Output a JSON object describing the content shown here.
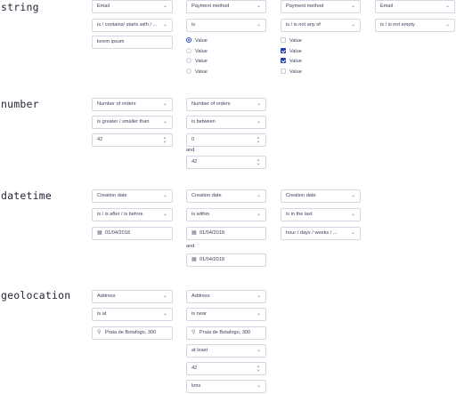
{
  "sections": {
    "string": "string",
    "number": "number",
    "datetime": "datetime",
    "geolocation": "geolocation"
  },
  "string": {
    "col1": {
      "field": "Email",
      "operator": "is / contains/ starts with / ...",
      "value": "lorem ipsum"
    },
    "col2": {
      "field": "Payment method",
      "operator": "is",
      "options": [
        {
          "label": "Value",
          "selected": true
        },
        {
          "label": "Value",
          "selected": false
        },
        {
          "label": "Value",
          "selected": false
        },
        {
          "label": "Value",
          "selected": false
        }
      ]
    },
    "col3": {
      "field": "Payment method",
      "operator": "is / is not any of",
      "options": [
        {
          "label": "Value",
          "checked": false
        },
        {
          "label": "Value",
          "checked": true
        },
        {
          "label": "Value",
          "checked": true
        },
        {
          "label": "Value",
          "checked": false
        }
      ]
    },
    "col4": {
      "field": "Email",
      "operator": "is / is not empty"
    }
  },
  "number": {
    "col1": {
      "field": "Number of orders",
      "operator": "is greater / smaller than",
      "value": "42"
    },
    "col2": {
      "field": "Number of orders",
      "operator": "is between",
      "from": "0",
      "and_label": "and",
      "to": "42"
    }
  },
  "datetime": {
    "col1": {
      "field": "Creation date",
      "operator": "is / is after / is before",
      "value": "01/04/2018"
    },
    "col2": {
      "field": "Creation date",
      "operator": "is within",
      "from": "01/04/2018",
      "and_label": "and",
      "to": "01/04/2018"
    },
    "col3": {
      "field": "Creation date",
      "operator": "is in the last",
      "unit": "hour / days / weeks / ..."
    }
  },
  "geolocation": {
    "col1": {
      "field": "Address",
      "operator": "is at",
      "location": "Praia de Botafogo, 300"
    },
    "col2": {
      "field": "Address",
      "operator": "is near",
      "location": "Praia de Botafogo, 300",
      "qualifier": "at least",
      "distance": "42",
      "unit": "kms"
    }
  },
  "icons": {
    "chevron": "chevron-down-icon",
    "calendar": "calendar-icon",
    "pin": "location-pin-icon",
    "stepper": "stepper-icon"
  }
}
